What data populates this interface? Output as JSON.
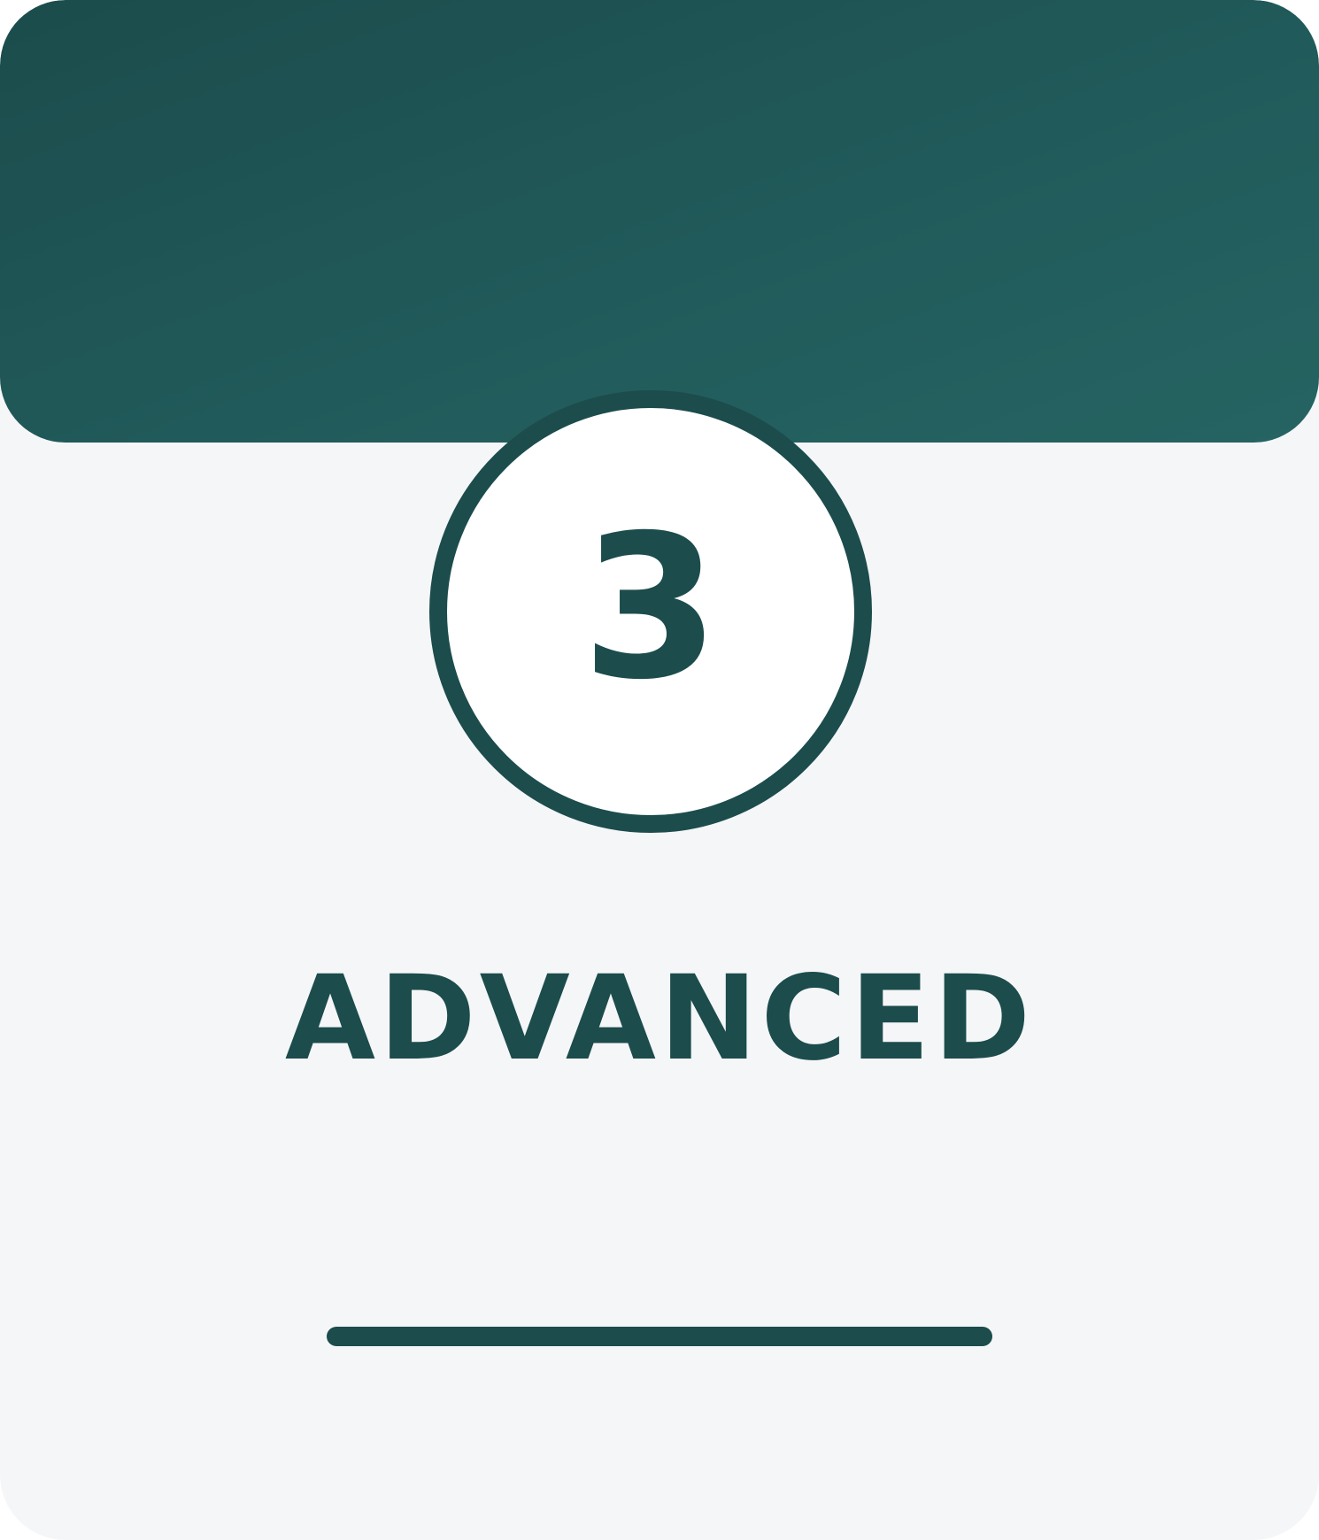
{
  "card": {
    "level_number": "3",
    "level_title": "ADVANCED"
  },
  "colors": {
    "primary": "#1c4c4c",
    "banner_gradient_end": "#256462",
    "card_background": "#f5f6f8",
    "badge_background": "#ffffff"
  }
}
